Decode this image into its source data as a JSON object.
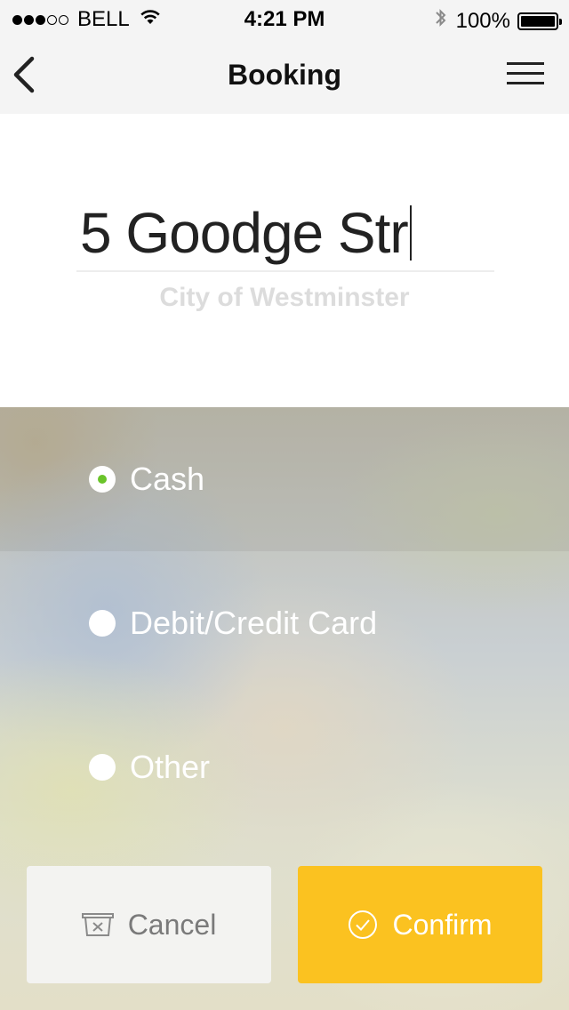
{
  "status_bar": {
    "carrier": "BELL",
    "time": "4:21 PM",
    "battery": "100%",
    "signal_bars_filled": 3,
    "signal_bars_total": 5
  },
  "nav": {
    "title": "Booking",
    "back_icon": "chevron-left-icon",
    "menu_icon": "hamburger-menu-icon"
  },
  "address": {
    "street": "5 Goodge Str",
    "district": "City of Westminster"
  },
  "payment_options": [
    {
      "label": "Cash",
      "selected": true
    },
    {
      "label": "Debit/Credit Card",
      "selected": false
    },
    {
      "label": "Other",
      "selected": false
    }
  ],
  "actions": {
    "cancel_label": "Cancel",
    "confirm_label": "Confirm"
  },
  "colors": {
    "accent": "#fbc220",
    "selected_radio": "#6ac42a",
    "nav_bg": "#f4f4f4"
  }
}
